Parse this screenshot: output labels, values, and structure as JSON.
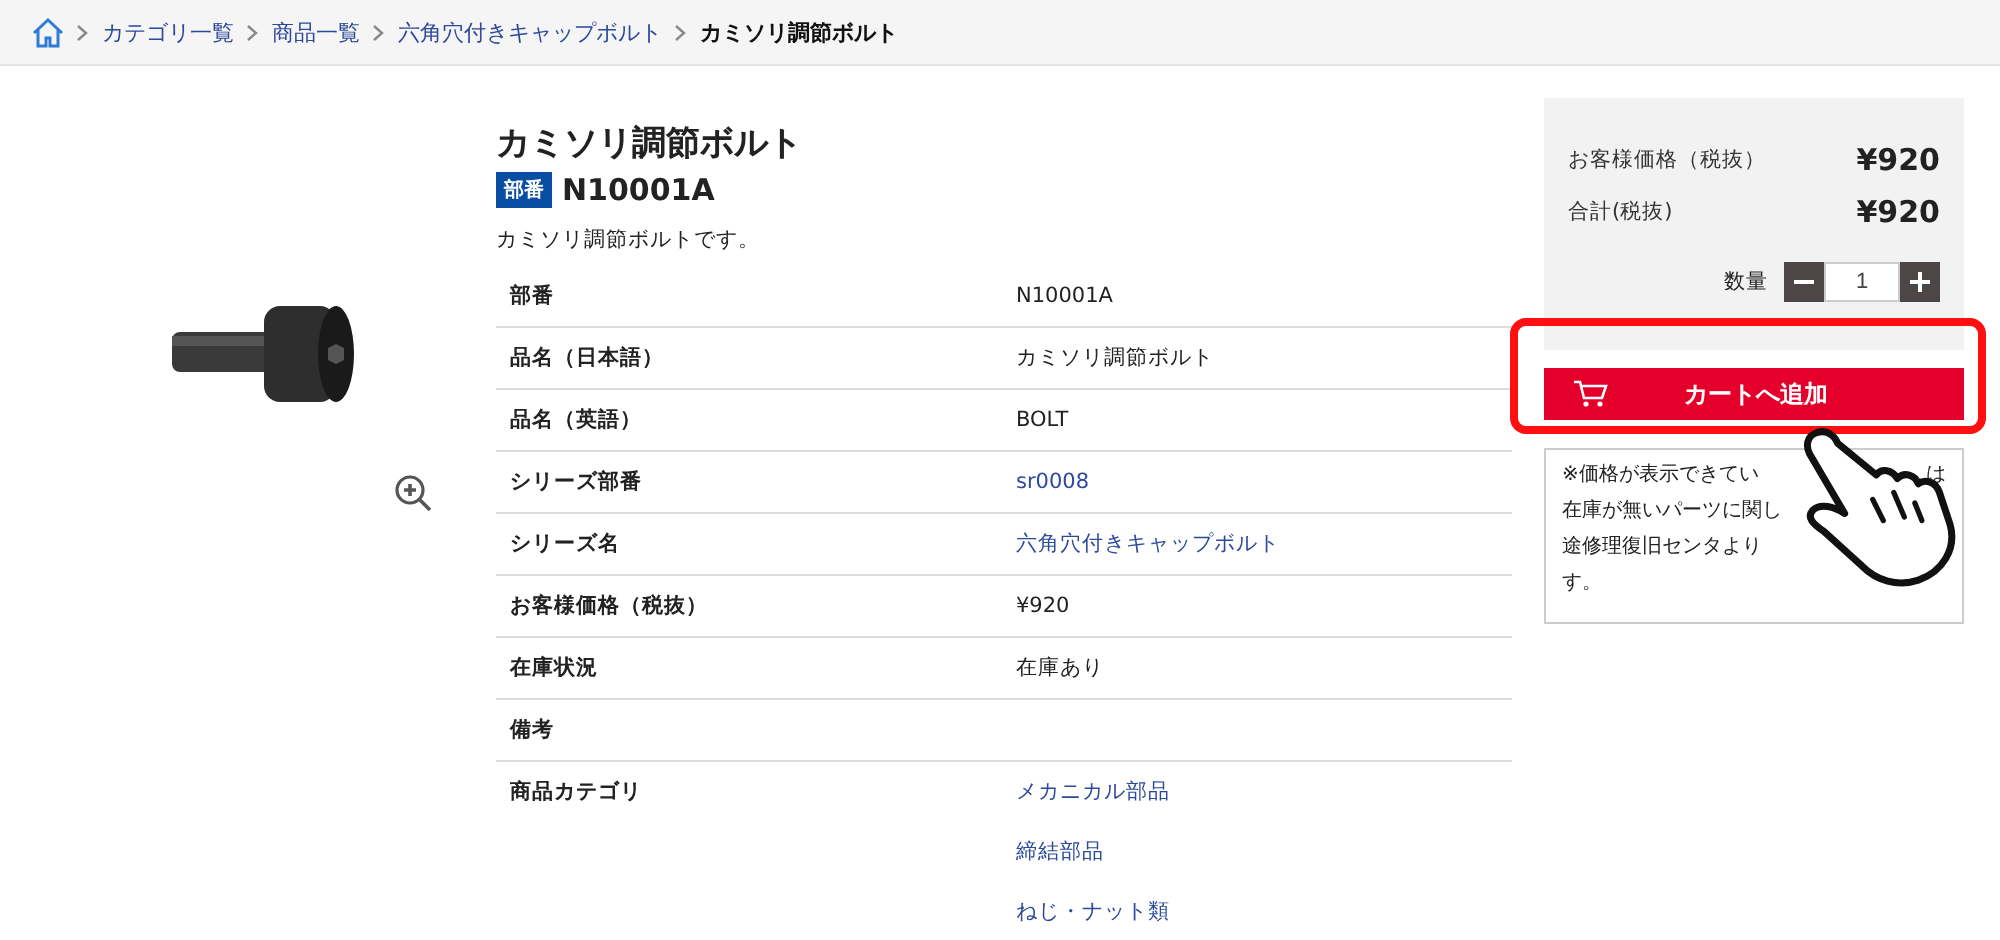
{
  "breadcrumb": [
    {
      "label": "カテゴリ一覧",
      "current": false
    },
    {
      "label": "商品一覧",
      "current": false
    },
    {
      "label": "六角穴付きキャップボルト",
      "current": false
    },
    {
      "label": "カミソリ調節ボルト",
      "current": true
    }
  ],
  "product": {
    "kind": "picture",
    "title": "カミソリ調節ボルト",
    "part_badge": "部番",
    "part_number": "N10001A",
    "description": "カミソリ調節ボルトです。"
  },
  "specs": [
    {
      "label": "部番",
      "values": [
        {
          "text": "N10001A",
          "link": false
        }
      ]
    },
    {
      "label": "品名（日本語）",
      "values": [
        {
          "text": "カミソリ調節ボルト",
          "link": false
        }
      ]
    },
    {
      "label": "品名（英語）",
      "values": [
        {
          "text": "BOLT",
          "link": false
        }
      ]
    },
    {
      "label": "シリーズ部番",
      "values": [
        {
          "text": "sr0008",
          "link": true
        }
      ]
    },
    {
      "label": "シリーズ名",
      "values": [
        {
          "text": "六角穴付きキャップボルト",
          "link": true
        }
      ]
    },
    {
      "label": "お客様価格（税抜）",
      "values": [
        {
          "text": "¥920",
          "link": false
        }
      ]
    },
    {
      "label": "在庫状況",
      "values": [
        {
          "text": "在庫あり",
          "link": false
        }
      ]
    },
    {
      "label": "備考"
    },
    {
      "label": "商品カテゴリ",
      "values": [
        {
          "text": "メカニカル部品",
          "link": true
        },
        {
          "text": "締結部品",
          "link": true
        },
        {
          "text": "ねじ・ナット類",
          "link": true
        }
      ]
    }
  ],
  "purchase": {
    "price_label": "お客様価格（税抜）",
    "price": "¥920",
    "total_label": "合計(税抜)",
    "total": "¥920",
    "quantity_label": "数量",
    "quantity": "1",
    "cart_button": "カートへ追加",
    "highlighted": true,
    "note_lines": [
      {
        "left": "※価格が表示できてい",
        "right": "は"
      },
      {
        "left": "在庫が無いパーツに関し"
      },
      {
        "left": "途修理復旧センタより"
      },
      {
        "left": "す。"
      }
    ]
  }
}
